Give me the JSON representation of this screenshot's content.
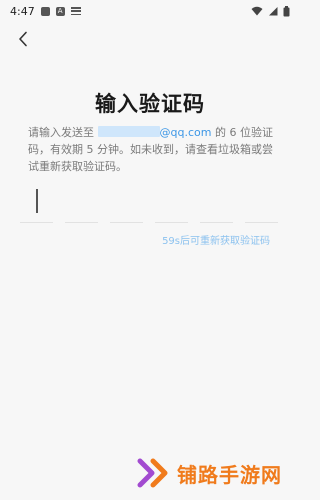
{
  "status_bar": {
    "time": "4:47",
    "notification_a": "A"
  },
  "header": {
    "back_icon": "chevron-left-icon"
  },
  "page": {
    "title": "输入验证码",
    "description_prefix": "请输入发送至 ",
    "email_domain": "@qq.com",
    "description_suffix": " 的 6 位验证码，有效期 5 分钟。如未收到，请查看垃圾箱或尝试重新获取验证码。",
    "resend_label": "59s后可重新获取验证码"
  },
  "code_input": {
    "length": 6,
    "values": [
      "",
      "",
      "",
      "",
      "",
      ""
    ]
  },
  "watermark": {
    "text": "铺路手游网",
    "icon": "double-chevron-logo",
    "color": "#f07b1c"
  },
  "colors": {
    "background": "#f7f7f7",
    "link": "#3d97e6",
    "resend": "#8cc2ef",
    "brand": "#f07b1c"
  }
}
